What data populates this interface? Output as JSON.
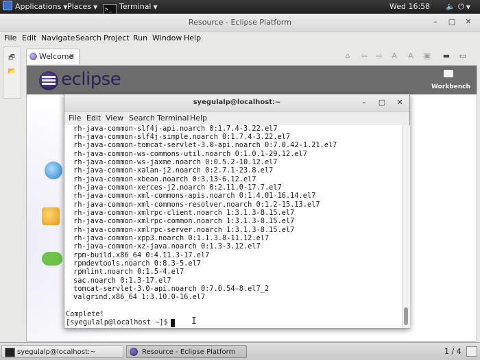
{
  "top_panel": {
    "applications": "Applications",
    "places": "Places",
    "terminal": "Terminal",
    "clock": "Wed 16:58"
  },
  "eclipse": {
    "title": "Resource - Eclipse Platform",
    "menus": [
      "File",
      "Edit",
      "Navigate",
      "Search",
      "Project",
      "Run",
      "Window",
      "Help"
    ],
    "tab_label": "Welcome",
    "logo_text": "eclipse",
    "workbench_label": "Workbench"
  },
  "terminal": {
    "title": "syegulalp@localhost:~",
    "menus": [
      "File",
      "Edit",
      "View",
      "Search",
      "Terminal",
      "Help"
    ],
    "lines": [
      "rh-java-common-slf4j-api.noarch 0:1.7.4-3.22.el7",
      "rh-java-common-slf4j-simple.noarch 0:1.7.4-3.22.el7",
      "rh-java-common-tomcat-servlet-3.0-api.noarch 0:7.0.42-1.21.el7",
      "rh-java-common-ws-commons-util.noarch 0:1.0.1-29.12.el7",
      "rh-java-common-ws-jaxme.noarch 0:0.5.2-10.12.el7",
      "rh-java-common-xalan-j2.noarch 0:2.7.1-23.8.el7",
      "rh-java-common-xbean.noarch 0:3.13-6.12.el7",
      "rh-java-common-xerces-j2.noarch 0:2.11.0-17.7.el7",
      "rh-java-common-xml-commons-apis.noarch 0:1.4.01-16.14.el7",
      "rh-java-common-xml-commons-resolver.noarch 0:1.2-15.13.el7",
      "rh-java-common-xmlrpc-client.noarch 1:3.1.3-8.15.el7",
      "rh-java-common-xmlrpc-common.noarch 1:3.1.3-8.15.el7",
      "rh-java-common-xmlrpc-server.noarch 1:3.1.3-8.15.el7",
      "rh-java-common-xpp3.noarch 0:1.1.3.8-11.12.el7",
      "rh-java-common-xz-java.noarch 0:1.3-3.12.el7",
      "rpm-build.x86_64 0:4.11.3-17.el7",
      "rpmdevtools.noarch 0:8.3-5.el7",
      "rpmlint.noarch 0:1.5-4.el7",
      "sac.noarch 0:1.3-17.el7",
      "tomcat-servlet-3.0-api.noarch 0:7.0.54-8.el7_2",
      "valgrind.x86_64 1:3.10.0-16.el7"
    ],
    "complete": "Complete!",
    "prompt": "[syegulalp@localhost ~]$ "
  },
  "taskbar": {
    "items": [
      "syegulalp@localhost:~",
      "Resource - Eclipse Platform"
    ],
    "workspace": "1 / 4"
  }
}
